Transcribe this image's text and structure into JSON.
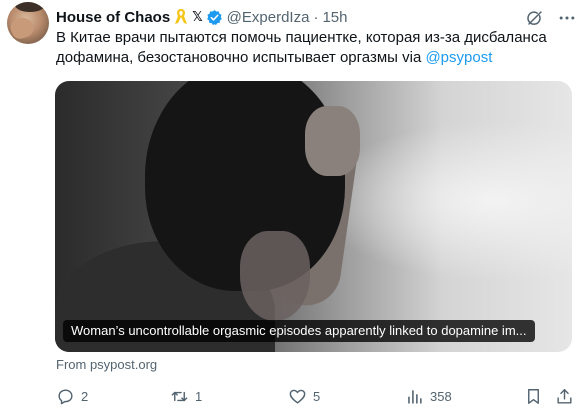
{
  "tweet": {
    "display_name": "House of Chaos",
    "handle": "@ExperdIza",
    "separator": "·",
    "time": "15h",
    "x_badge": "𝕏",
    "icons": [
      "yellow-ribbon-icon",
      "x-logo-icon",
      "verified-badge-icon",
      "grok-icon",
      "more-icon"
    ],
    "text_main": "В Китае врачи пытаются помочь пациентке, которая из-за дисбаланса дофамина, безостановочно испытывает оргазмы via ",
    "mention": "@psypost",
    "link_card": {
      "caption": "Woman’s uncontrollable orgasmic episodes apparently linked to dopamine im...",
      "source": "From psypost.org"
    },
    "actions": {
      "replies": "2",
      "reposts": "1",
      "likes": "5",
      "views": "358"
    },
    "colors": {
      "accent": "#1d9bf0",
      "secondary_text": "#536471",
      "ribbon": "#f5c518"
    }
  }
}
